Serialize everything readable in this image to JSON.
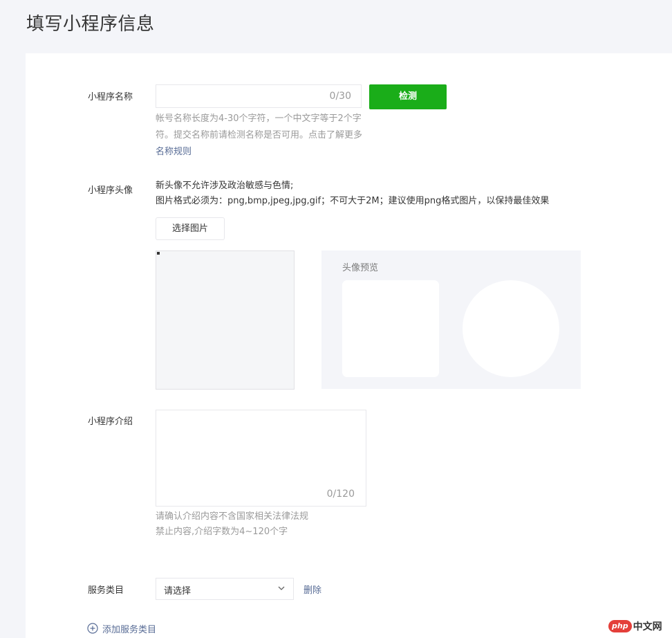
{
  "page": {
    "title": "填写小程序信息"
  },
  "name_section": {
    "label": "小程序名称",
    "input_value": "",
    "counter": "0/30",
    "check_button": "检测",
    "help_text": "帐号名称长度为4-30个字符，一个中文字等于2个字符。提交名称前请检测名称是否可用。点击了解更多",
    "help_link": "名称规则"
  },
  "avatar_section": {
    "label": "小程序头像",
    "rule_line1": "新头像不允许涉及政治敏感与色情;",
    "rule_line2": "图片格式必须为：png,bmp,jpeg,jpg,gif；不可大于2M；建议使用png格式图片，以保持最佳效果",
    "select_button": "选择图片",
    "preview_title": "头像预览"
  },
  "intro_section": {
    "label": "小程序介绍",
    "counter": "0/120",
    "help_line1": "请确认介绍内容不含国家相关法律法规",
    "help_line2": "禁止内容,介绍字数为4~120个字"
  },
  "category_section": {
    "label": "服务类目",
    "select_value": "请选择",
    "delete_link": "删除",
    "add_link": "添加服务类目"
  },
  "watermark": {
    "badge": "php",
    "text": "中文网"
  },
  "colors": {
    "accent_green": "#1aad19",
    "link_blue": "#576b95",
    "page_bg": "#f4f5f9"
  },
  "icons": [
    "chevron-down-icon",
    "plus-circle-icon"
  ]
}
